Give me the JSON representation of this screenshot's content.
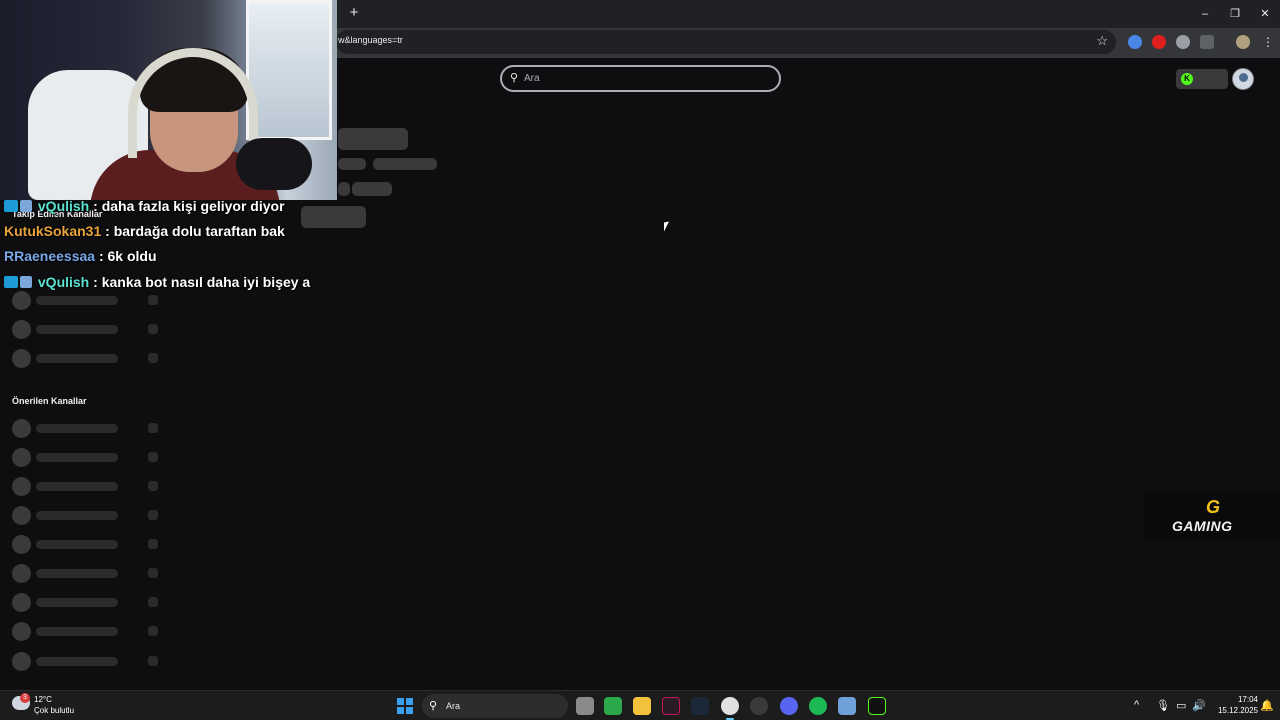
{
  "browser": {
    "new_tab": "+",
    "url": "w&languages=tr",
    "controls": {
      "minimize": "–",
      "restore": "❐",
      "close": "✕"
    }
  },
  "page": {
    "search_placeholder": "Ara",
    "followed_title": "Takip Edilen Kanallar",
    "recommended_title": "Önerilen Kanallar"
  },
  "chat": [
    {
      "user": "vQulish",
      "user_color": "#5be3d1",
      "badges": true,
      "text": " : daha fazla kişi geliyor diyor"
    },
    {
      "user": "KutukSokan31",
      "user_color": "#e8a33a",
      "badges": false,
      "text": " : bardağa dolu taraftan bak"
    },
    {
      "user": "RRaeneessaa",
      "user_color": "#7aa7e8",
      "badges": false,
      "text": " : 6k oldu"
    },
    {
      "user": "vQulish",
      "user_color": "#5be3d1",
      "badges": true,
      "text": " : kanka bot nasıl daha iyi bişey a"
    }
  ],
  "overlay": {
    "logo_text": "GAMING",
    "logo_mark": "G"
  },
  "taskbar": {
    "weather_temp": "12°C",
    "weather_cond": "Çok bulutlu",
    "weather_badge": "3",
    "search_placeholder": "Ara",
    "time": "17:04",
    "date": "15.12.2025"
  },
  "colors": {
    "twitch_bg": "#0e0e10",
    "kick_green": "#53fc18",
    "windows_blue": "#3aa0f2"
  }
}
